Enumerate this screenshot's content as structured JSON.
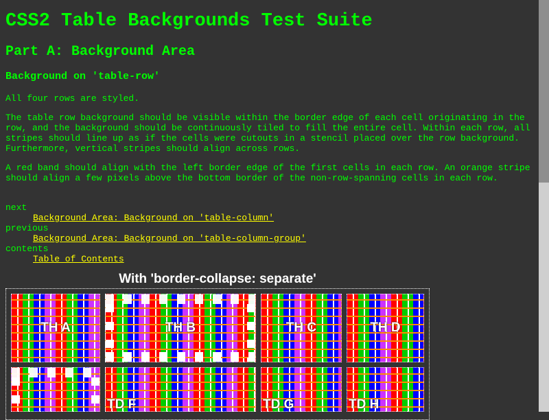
{
  "page": {
    "title": "CSS2 Table Backgrounds Test Suite",
    "part": "Part A: Background Area",
    "section": "Background on 'table-row'",
    "p1": "All four rows are styled.",
    "p2": "The table row background should be visible within the border edge of each cell originating in the row, and the background should be continuously tiled to fill the entire cell. Within each row, all stripes should line up as if the cells were cutouts in a stencil placed over the row background. Furthermore, vertical stripes should align across rows.",
    "p3": "A red band should align with the left border edge of the first cells in each row. An orange stripe should align a few pixels above the bottom border of the non-row-spanning cells in each row."
  },
  "nav": {
    "next_label": "next",
    "next_link": "Background Area: Background on 'table-column'",
    "previous_label": "previous",
    "previous_link": "Background Area: Background on 'table-column-group'",
    "contents_label": "contents",
    "contents_link": "Table of Contents"
  },
  "table": {
    "caption": "With 'border-collapse: separate'",
    "cells": [
      "TH A",
      "TH B",
      "TH C",
      "TH D",
      "TD F",
      "TD G",
      "TD H"
    ]
  },
  "colors": {
    "background": "#333333",
    "text": "#00ff00",
    "link": "#ffff00"
  }
}
